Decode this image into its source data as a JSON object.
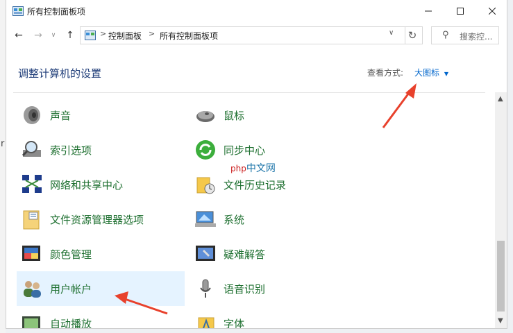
{
  "window": {
    "title": "所有控制面板项",
    "minimize_icon": "minimize-icon",
    "maximize_icon": "maximize-icon",
    "close_icon": "close-icon"
  },
  "nav": {
    "breadcrumb": [
      "控制面板",
      "所有控制面板项"
    ],
    "search_placeholder": "搜索控..."
  },
  "header": {
    "title": "调整计算机的设置",
    "view_by_label": "查看方式:",
    "view_by_value": "大图标"
  },
  "items_left": [
    {
      "label": "声音",
      "icon": "speaker-icon"
    },
    {
      "label": "索引选项",
      "icon": "indexing-magnifier-icon"
    },
    {
      "label": "网络和共享中心",
      "icon": "network-icon"
    },
    {
      "label": "文件资源管理器选项",
      "icon": "folder-options-icon"
    },
    {
      "label": "颜色管理",
      "icon": "color-management-icon"
    },
    {
      "label": "用户帐户",
      "icon": "user-accounts-icon",
      "selected": true
    },
    {
      "label": "自动播放",
      "icon": "autoplay-icon"
    }
  ],
  "items_right": [
    {
      "label": "鼠标",
      "icon": "mouse-icon"
    },
    {
      "label": "同步中心",
      "icon": "sync-icon"
    },
    {
      "label": "文件历史记录",
      "icon": "file-history-icon"
    },
    {
      "label": "系统",
      "icon": "system-icon"
    },
    {
      "label": "疑难解答",
      "icon": "troubleshooting-icon"
    },
    {
      "label": "语音识别",
      "icon": "microphone-icon"
    },
    {
      "label": "字体",
      "icon": "fonts-icon"
    }
  ],
  "watermark": {
    "brand": "php",
    "text": "中文网"
  },
  "colors": {
    "link_green": "#1d6f2f",
    "accent_blue": "#0066cc",
    "heading_blue": "#1e3c78",
    "arrow_red": "#e8412c",
    "selected_bg": "#e5f3ff"
  }
}
